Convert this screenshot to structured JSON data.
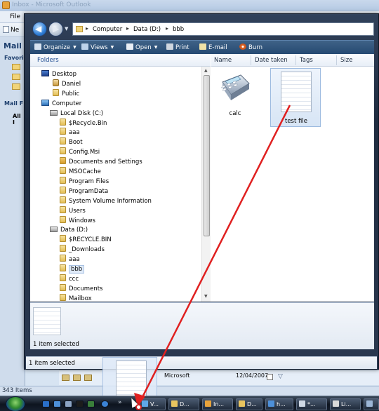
{
  "outlook": {
    "title": "Inbox - Microsoft Outlook",
    "menu_file": "File",
    "toolbar_new": "Ne",
    "nav_mail": "Mail",
    "nav_favorites": "Favorit",
    "nav_mail_folders": "Mail F",
    "nav_all": "All I",
    "status_items": "343 Items",
    "message_from": "Microsoft",
    "message_date": "12/04/2007"
  },
  "explorer": {
    "breadcrumb": [
      "Computer",
      "Data (D:)",
      "bbb"
    ],
    "toolbar": {
      "organize": "Organize",
      "views": "Views",
      "open": "Open",
      "print": "Print",
      "email": "E-mail",
      "burn": "Burn"
    },
    "folders_header": "Folders",
    "tree": [
      {
        "label": "Desktop",
        "icon": "desktop-icon"
      },
      {
        "label": "Daniel",
        "icon": "user-folder-icon"
      },
      {
        "label": "Public",
        "icon": "folder-icon"
      },
      {
        "label": "Computer",
        "icon": "computer-icon"
      },
      {
        "label": "Local Disk (C:)",
        "icon": "drive-icon"
      },
      {
        "label": "$Recycle.Bin",
        "icon": "folder-icon"
      },
      {
        "label": "aaa",
        "icon": "folder-icon"
      },
      {
        "label": "Boot",
        "icon": "folder-icon"
      },
      {
        "label": "Config.Msi",
        "icon": "folder-icon"
      },
      {
        "label": "Documents and Settings",
        "icon": "shortcut-folder-icon"
      },
      {
        "label": "MSOCache",
        "icon": "folder-icon"
      },
      {
        "label": "Program Files",
        "icon": "folder-icon"
      },
      {
        "label": "ProgramData",
        "icon": "folder-icon"
      },
      {
        "label": "System Volume Information",
        "icon": "folder-icon"
      },
      {
        "label": "Users",
        "icon": "folder-icon"
      },
      {
        "label": "Windows",
        "icon": "folder-icon"
      },
      {
        "label": "Data (D:)",
        "icon": "drive-icon"
      },
      {
        "label": "$RECYCLE.BIN",
        "icon": "folder-icon"
      },
      {
        "label": "_Downloads",
        "icon": "folder-icon"
      },
      {
        "label": "aaa",
        "icon": "folder-icon"
      },
      {
        "label": "bbb",
        "icon": "folder-icon",
        "selected": true
      },
      {
        "label": "ccc",
        "icon": "folder-icon"
      },
      {
        "label": "Documents",
        "icon": "folder-icon"
      },
      {
        "label": "Mailbox",
        "icon": "folder-icon"
      }
    ],
    "columns": [
      "Name",
      "Date taken",
      "Tags",
      "Size"
    ],
    "files": [
      {
        "label": "calc",
        "icon": "calculator-icon"
      },
      {
        "label": "test file",
        "icon": "text-document-icon",
        "selected": true
      }
    ],
    "preview_status": "1 item selected",
    "status": "1 item selected"
  },
  "taskbar": {
    "overflow": "»",
    "tasks": [
      "V...",
      "D...",
      "In...",
      "D...",
      "h...",
      "*...",
      "Li...",
      ""
    ]
  },
  "colors": {
    "accent_arrow": "#e02020",
    "toolbar_blue": "#264a72",
    "selection": "#dfeaf8"
  }
}
